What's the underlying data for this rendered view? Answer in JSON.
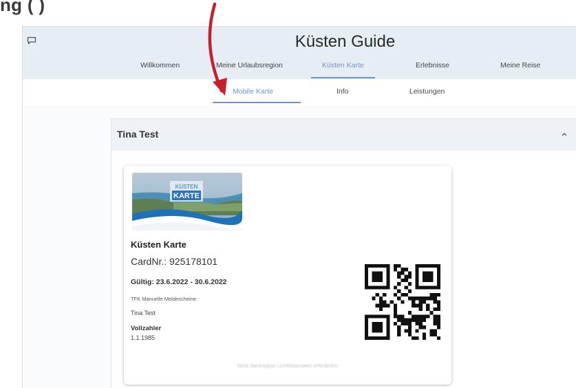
{
  "caption": "ng           (              )",
  "app": {
    "title": "Küsten Guide",
    "nav": [
      {
        "label": "Willkommen"
      },
      {
        "label": "Meine Urlaubsregion"
      },
      {
        "label": "Küsten Karte"
      },
      {
        "label": "Erlebnisse"
      },
      {
        "label": "Meine Reise"
      }
    ],
    "subnav": [
      {
        "label": "Mobile Karte"
      },
      {
        "label": "Info"
      },
      {
        "label": "Leistungen"
      }
    ]
  },
  "panel": {
    "title": "Tina Test"
  },
  "card": {
    "logo_line1": "KÜSTEN",
    "logo_line2": "KARTE",
    "name": "Küsten Karte",
    "card_nr": "CardNr.: 925178101",
    "valid": "Gültig: 23.6.2022 - 30.6.2022",
    "org": "TFK Manuelle Meldescheine",
    "holder": "Tina Test",
    "type": "Vollzahler",
    "dob": "1.1.1985",
    "note": "Nicht übertragbar! Lichtbildausweis erforderlich"
  },
  "colors": {
    "accent": "#6f93c8",
    "header_bg": "#e7edf4",
    "arrow": "#c8202a"
  }
}
